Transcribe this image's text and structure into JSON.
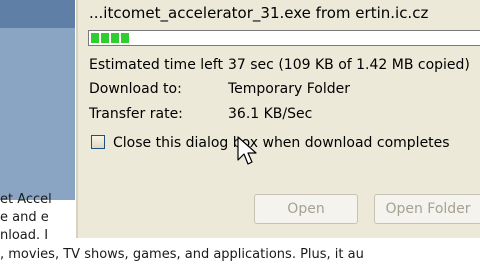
{
  "dialog": {
    "filename": "...itcomet_accelerator_31.exe from ertin.ic.cz",
    "progress": {
      "fraction": 0.05,
      "segments": 4
    },
    "rows": [
      {
        "label": "Estimated time left",
        "value": "37 sec (109 KB of 1.42 MB copied)"
      },
      {
        "label": "Download to:",
        "value": "Temporary Folder"
      },
      {
        "label": "Transfer rate:",
        "value": "36.1 KB/Sec"
      }
    ],
    "close_checkbox": {
      "label": "Close this dialog box when download completes",
      "checked": false
    },
    "buttons": {
      "open": "Open",
      "open_folder": "Open Folder"
    }
  },
  "background_page": {
    "lines": [
      "et Accel",
      "e and e",
      "nload. I",
      ", movies, TV shows, games, and applications. Plus, it au"
    ]
  },
  "colors": {
    "dialog_bg": "#ece9d8",
    "progress_fill": "#2fce2f",
    "page_accent": "#5f7fa6"
  }
}
